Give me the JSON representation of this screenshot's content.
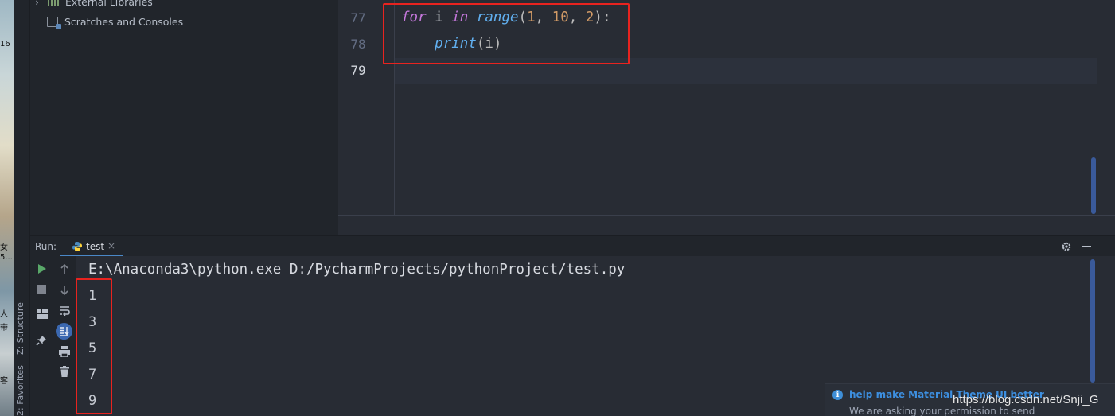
{
  "desktop": {
    "fragments": [
      "16",
      "女",
      "5...",
      "人",
      "带",
      "客"
    ]
  },
  "left_stripe": {
    "structure_label": "Z: Structure",
    "favorites_label": "2: Favorites"
  },
  "project_tree": {
    "items": [
      {
        "label": "External Libraries",
        "icon": "library-icon"
      },
      {
        "label": "Scratches and Consoles",
        "icon": "scratches-icon"
      }
    ]
  },
  "editor": {
    "lines": [
      {
        "number": "77",
        "tokens": [
          {
            "t": "for",
            "c": "kw"
          },
          {
            "t": " i ",
            "c": "var"
          },
          {
            "t": "in",
            "c": "kw"
          },
          {
            "t": " ",
            "c": "var"
          },
          {
            "t": "range",
            "c": "fn"
          },
          {
            "t": "(",
            "c": "punc"
          },
          {
            "t": "1",
            "c": "num"
          },
          {
            "t": ", ",
            "c": "punc"
          },
          {
            "t": "10",
            "c": "num"
          },
          {
            "t": ", ",
            "c": "punc"
          },
          {
            "t": "2",
            "c": "num"
          },
          {
            "t": "):",
            "c": "punc"
          }
        ]
      },
      {
        "number": "78",
        "tokens": [
          {
            "t": "    ",
            "c": "var"
          },
          {
            "t": "print",
            "c": "fn"
          },
          {
            "t": "(i)",
            "c": "punc"
          }
        ]
      },
      {
        "number": "79",
        "tokens": []
      }
    ],
    "current_line": "79"
  },
  "run_panel": {
    "label": "Run:",
    "tab_name": "test",
    "tab_close": "×",
    "settings_icon": "gear-icon",
    "minimize_icon": "minimize-icon",
    "toolbar_left": [
      "run-icon",
      "stop-icon",
      "layout-icon",
      "pin-icon"
    ],
    "toolbar_right": [
      "arrow-up-icon",
      "arrow-down-icon",
      "soft-wrap-icon",
      "scroll-to-end-icon",
      "print-icon",
      "trash-icon"
    ],
    "command": "E:\\Anaconda3\\python.exe D:/PycharmProjects/pythonProject/test.py",
    "output": [
      "1",
      "3",
      "5",
      "7",
      "9"
    ]
  },
  "notification": {
    "title": "help make Material Theme UI better",
    "body": "We are asking your permission to send"
  },
  "watermark": "https://blog.csdn.net/Snji_G",
  "colors": {
    "keyword": "#c678dd",
    "function": "#61afef",
    "number": "#d19a66",
    "highlight_box": "#e8231f",
    "accent": "#4a88c7"
  }
}
